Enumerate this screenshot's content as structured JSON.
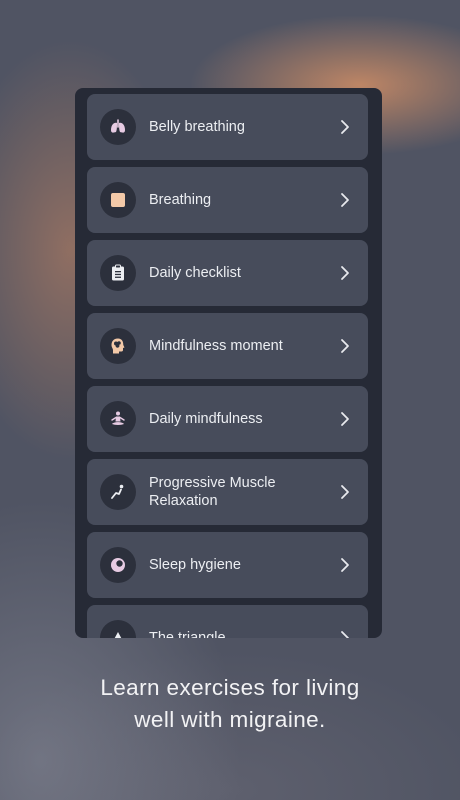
{
  "exercises": [
    {
      "label": "Belly breathing",
      "icon": "lungs-icon"
    },
    {
      "label": "Breathing",
      "icon": "square-icon"
    },
    {
      "label": "Daily checklist",
      "icon": "clipboard-icon"
    },
    {
      "label": "Mindfulness moment",
      "icon": "head-brain-icon"
    },
    {
      "label": "Daily mindfulness",
      "icon": "meditation-icon"
    },
    {
      "label": "Progressive Muscle Relaxation",
      "icon": "muscle-relaxation-icon"
    },
    {
      "label": "Sleep hygiene",
      "icon": "moon-icon"
    },
    {
      "label": "The triangle",
      "icon": "triangle-icon"
    }
  ],
  "caption": {
    "line1": "Learn exercises for living",
    "line2": "well with migraine."
  },
  "colors": {
    "background": "#505463",
    "panel": "#262a36",
    "card": "#474c5b",
    "icon_circle": "#2c303c",
    "icon_accent": "#f3c9a8",
    "icon_lavender": "#e7cbe3",
    "text": "#eceef2"
  }
}
